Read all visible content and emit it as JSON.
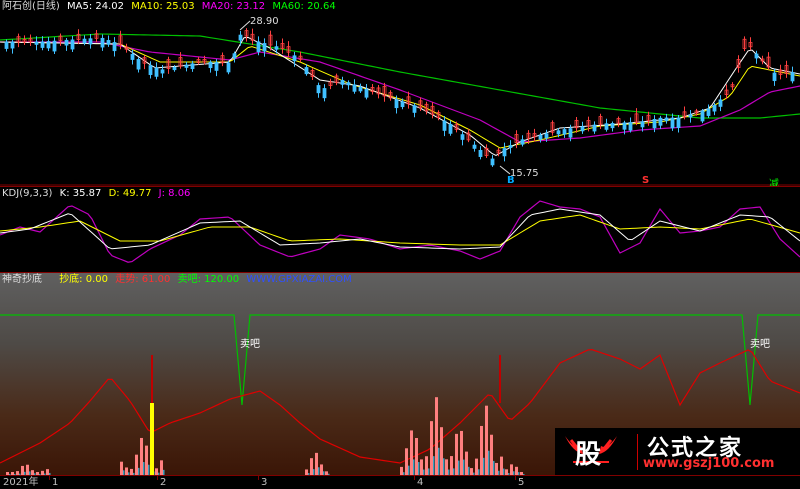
{
  "price_pane": {
    "title": "阿石创(日线)",
    "ma": [
      {
        "label": "MA5: 24.02",
        "color": "#ffffff"
      },
      {
        "label": "MA10: 25.03",
        "color": "#ffff00"
      },
      {
        "label": "MA20: 23.12",
        "color": "#ff00ff"
      },
      {
        "label": "MA60: 20.64",
        "color": "#00ff00"
      }
    ],
    "high_label": "28.90",
    "low_label": "15.75",
    "markers": [
      {
        "text": "B",
        "color": "#00aaff"
      },
      {
        "text": "S",
        "color": "#ff3030"
      },
      {
        "text": "减",
        "color": "#00ff00"
      }
    ]
  },
  "kdj_pane": {
    "title": "KDJ(9,3,3)",
    "values": [
      {
        "label": "K: 35.87",
        "color": "#ffffff"
      },
      {
        "label": "D: 49.77",
        "color": "#ffff00"
      },
      {
        "label": "J: 8.06",
        "color": "#ff00ff"
      }
    ]
  },
  "indicator_pane": {
    "title": "神奇抄底",
    "values": [
      {
        "label": "抄底: 0.00",
        "color": "#ffff00"
      },
      {
        "label": "走势: 61.00",
        "color": "#ff3030"
      },
      {
        "label": "卖吧: 120.00",
        "color": "#00ff00"
      },
      {
        "label": "WWW.GPXIAZAI.COM",
        "color": "#3050ff"
      }
    ],
    "sell_label": "卖吧",
    "colors": {
      "trend": "#e00000",
      "sell": "#00c000",
      "bars": "#ff8080",
      "cyan": "#40a0c0",
      "signal": "#ffff00"
    }
  },
  "time_axis": {
    "labels": [
      "2021年",
      "1",
      "2",
      "3",
      "4",
      "5"
    ]
  },
  "watermark": {
    "logo_char": "股",
    "title": "公式之家",
    "url": "www.gszj100.com"
  }
}
